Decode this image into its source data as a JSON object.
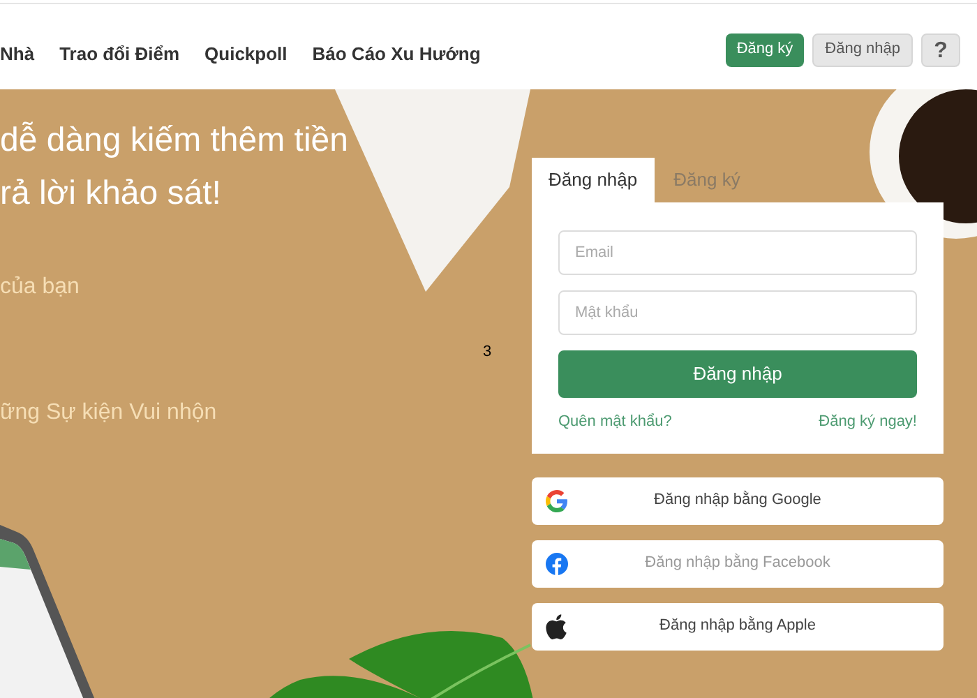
{
  "nav": [
    {
      "label": "Nhà"
    },
    {
      "label": "Trao đổi Điểm"
    },
    {
      "label": "Quickpoll"
    },
    {
      "label": "Báo Cáo Xu Hướng"
    }
  ],
  "header_buttons": [
    {
      "kind": "primary",
      "label": "Đăng ký"
    },
    {
      "kind": "secondary",
      "label": "Đăng nhập"
    },
    {
      "kind": "help",
      "label": "?"
    }
  ],
  "hero": {
    "headline": [
      "dễ dàng kiếm thêm tiền",
      "rả lời khảo sát!"
    ],
    "subtitle": "của bạn",
    "events": "ững Sự kiện Vui nhộn",
    "marker": "3"
  },
  "login": {
    "tabs": [
      {
        "label": "Đăng nhập",
        "selected": true
      },
      {
        "label": "Đăng ký",
        "selected": false
      }
    ],
    "fields": [
      {
        "placeholder": "Email"
      },
      {
        "placeholder": "Mật khẩu"
      }
    ],
    "submit": "Đăng nhập",
    "forgot": "Quên mật khẩu?",
    "register": "Đăng ký ngay!"
  },
  "social": [
    {
      "kind": "google",
      "label": "Đăng nhập bằng Google"
    },
    {
      "kind": "facebook",
      "label": "Đăng nhập bằng Facebook"
    },
    {
      "kind": "apple",
      "label": "Đăng nhập bằng Apple"
    }
  ]
}
